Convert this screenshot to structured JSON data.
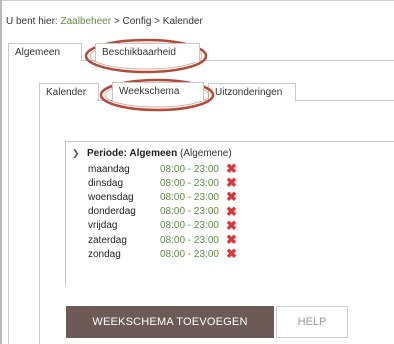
{
  "breadcrumb": {
    "prefix": "U bent hier:",
    "items": [
      "Zaalbeheer",
      "Config",
      "Kalender"
    ],
    "separator": ">"
  },
  "outer_tabs": [
    {
      "label": "Algemeen",
      "active": false
    },
    {
      "label": "Beschikbaarheid",
      "active": true
    }
  ],
  "inner_tabs": [
    {
      "label": "Kalender",
      "active": false
    },
    {
      "label": "Weekschema",
      "active": true
    },
    {
      "label": "Uitzonderingen",
      "active": false
    }
  ],
  "period": {
    "title": "Periode: Algemeen",
    "subtitle": "(Algemene)",
    "days": [
      {
        "name": "maandag",
        "time": "08:00 - 23:00"
      },
      {
        "name": "dinsdag",
        "time": "08:00 - 23:00"
      },
      {
        "name": "woensdag",
        "time": "08:00 - 23:00"
      },
      {
        "name": "donderdag",
        "time": "08:00 - 23:00"
      },
      {
        "name": "vrijdag",
        "time": "08:00 - 23:00"
      },
      {
        "name": "zaterdag",
        "time": "08:00 - 23:00"
      },
      {
        "name": "zondag",
        "time": "08:00 - 23:00"
      }
    ]
  },
  "buttons": {
    "add_label": "WEEKSCHEMA TOEVOEGEN",
    "help_label": "HELP"
  },
  "colors": {
    "link": "#5c8f3d",
    "delete": "#e3333a",
    "primary_button": "#6b5a55",
    "highlight_ellipse": "#b54a37"
  }
}
